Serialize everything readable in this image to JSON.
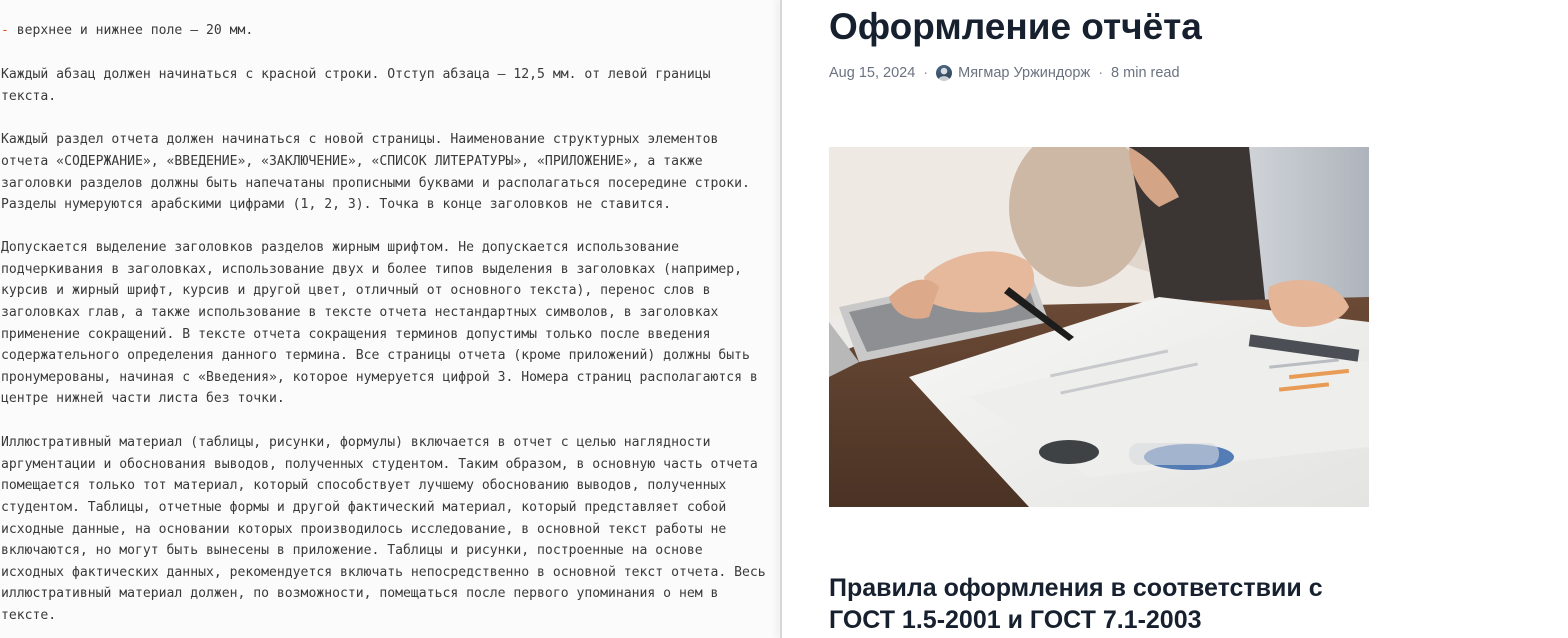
{
  "source": {
    "lines": [
      {
        "dash": "-",
        "text": " верхнее и нижнее поле – 20 мм."
      },
      {
        "text": "Каждый абзац должен начинаться с красной строки. Отступ абзаца – 12,5 мм. от левой границы"
      },
      {
        "text": "текста."
      },
      {
        "text": "Каждый раздел отчета должен начинаться с новой страницы. Наименование структурных элементов"
      },
      {
        "text": "отчета «СОДЕРЖАНИЕ», «ВВЕДЕНИЕ», «ЗАКЛЮЧЕНИЕ», «СПИСОК ЛИТЕРАТУРЫ», «ПРИЛОЖЕНИЕ», а также"
      },
      {
        "text": "заголовки разделов должны быть напечатаны прописными буквами и располагаться посередине строки."
      },
      {
        "text": "Разделы нумеруются арабскими цифрами (1, 2, 3). Точка в конце заголовков не ставится."
      },
      {
        "text": "Допускается выделение заголовков разделов жирным шрифтом. Не допускается использование"
      },
      {
        "text": "подчеркивания в заголовках, использование двух и более типов выделения в заголовках (например,"
      },
      {
        "text": "курсив и жирный шрифт, курсив и другой цвет, отличный от основного текста), перенос слов в"
      },
      {
        "text": "заголовках глав, а также использование в тексте отчета нестандартных символов, в заголовках"
      },
      {
        "text": "применение сокращений. В тексте отчета сокращения терминов допустимы только после введения"
      },
      {
        "text": "содержательного определения данного термина. Все страницы отчета (кроме приложений) должны быть"
      },
      {
        "text": "пронумерованы, начиная с «Введения», которое нумеруется цифрой 3. Номера страниц располагаются в"
      },
      {
        "text": "центре нижней части листа без точки."
      },
      {
        "text": "Иллюстративный материал (таблицы, рисунки, формулы) включается в отчет с целью наглядности"
      },
      {
        "text": "аргументации и обоснования выводов, полученных студентом. Таким образом, в основную часть отчета"
      },
      {
        "text": "помещается только тот материал, который способствует лучшему обоснованию выводов, полученных"
      },
      {
        "text": "студентом. Таблицы, отчетные формы и другой фактический материал, который представляет собой"
      },
      {
        "text": "исходные данные, на основании которых производилось исследование, в основной текст работы не"
      },
      {
        "text": "включаются, но могут быть вынесены в приложение. Таблицы и рисунки, построенные на основе"
      },
      {
        "text": "исходных фактических данных, рекомендуется включать непосредственно в основной текст отчета. Весь"
      },
      {
        "text": "иллюстративный материал должен, по возможности, помещаться после первого упоминания о нем в"
      },
      {
        "text": "тексте."
      }
    ]
  },
  "preview": {
    "title": "Оформление отчёта",
    "date": "Aug 15, 2024",
    "separator": "·",
    "author": "Мягмар Уржиндорж",
    "read_time": "8 min read",
    "subheading": "Правила оформления в соответствии с ГОСТ 1.5-2001 и ГОСТ 7.1-2003"
  },
  "icons": {
    "author_avatar": "author-avatar",
    "hero_image": "hero-photo-documents-pen-laptop"
  },
  "colors": {
    "list_marker": "#e0531f",
    "heading": "#16202e",
    "meta_text": "#6b7280",
    "source_text": "#3a3a3a"
  }
}
